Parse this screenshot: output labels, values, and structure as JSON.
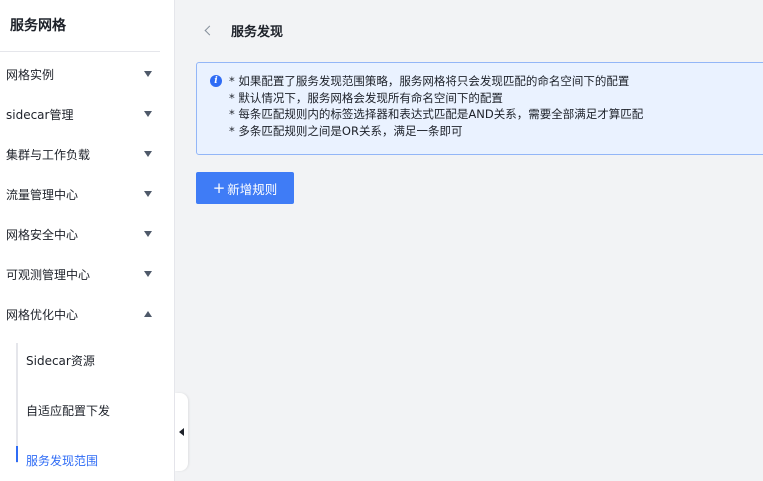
{
  "sidebar": {
    "title": "服务网格",
    "items": [
      {
        "label": "网格实例",
        "expanded": false
      },
      {
        "label": "sidecar管理",
        "expanded": false
      },
      {
        "label": "集群与工作负载",
        "expanded": false
      },
      {
        "label": "流量管理中心",
        "expanded": false
      },
      {
        "label": "网格安全中心",
        "expanded": false
      },
      {
        "label": "可观测管理中心",
        "expanded": false
      },
      {
        "label": "网格优化中心",
        "expanded": true
      }
    ],
    "subitems": [
      {
        "label": "Sidecar资源",
        "active": false
      },
      {
        "label": "自适应配置下发",
        "active": false
      },
      {
        "label": "服务发现范围",
        "active": true
      }
    ]
  },
  "header": {
    "back_icon": "chevron-left-icon",
    "title": "服务发现"
  },
  "notice": {
    "icon": "info-icon",
    "lines": [
      "* 如果配置了服务发现范围策略，服务网格将只会发现匹配的命名空间下的配置",
      "* 默认情况下，服务网格会发现所有命名空间下的配置",
      "* 每条匹配规则内的标签选择器和表达式匹配是AND关系，需要全部满足才算匹配",
      "* 多条匹配规则之间是OR关系，满足一条即可"
    ]
  },
  "toolbar": {
    "add_label": "新增规则"
  },
  "colors": {
    "accent": "#2f6cf5",
    "button": "#3f7cf6",
    "notice_bg": "#eaf2ff",
    "notice_border": "#93b6f7",
    "page_bg": "#f2f3f5"
  }
}
